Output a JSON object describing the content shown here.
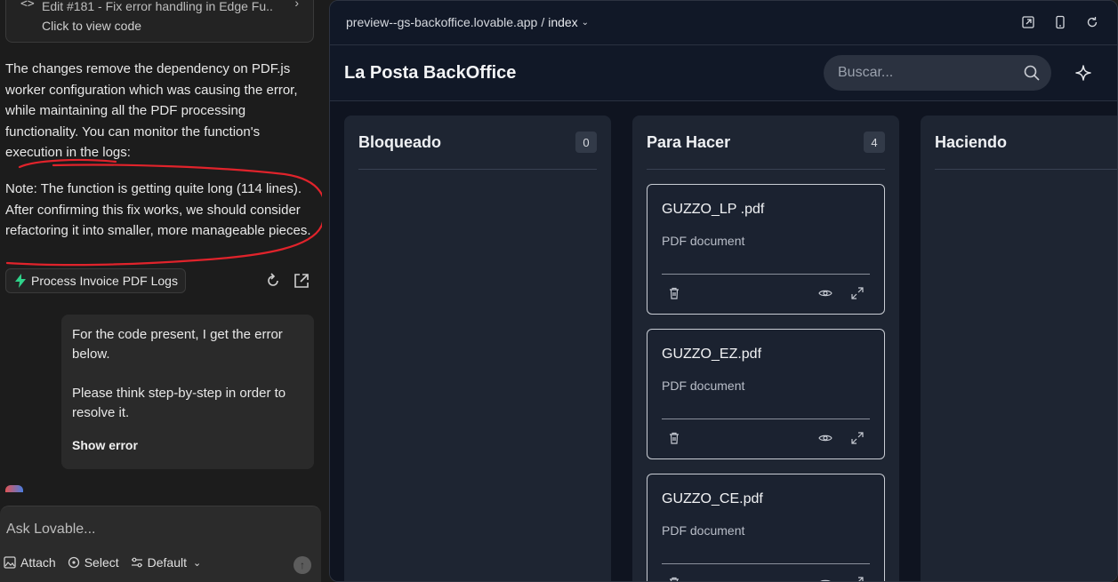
{
  "chat": {
    "code_card": {
      "glyph": "<>",
      "title": "Edit #181 - Fix error handling in Edge Fu...",
      "subtitle": "Click to view code"
    },
    "paragraph1": "The changes remove the dependency on PDF.js worker configuration which was causing the error, while maintaining all the PDF processing functionality. You can monitor the function's execution in the logs:",
    "paragraph2": "Note: The function is getting quite long (114 lines). After confirming this fix works, we should consider refactoring it into smaller, more manageable pieces.",
    "logs_chip": "Process Invoice PDF Logs",
    "user_message": {
      "line1": "For the code present, I get the error below.",
      "line2": "Please think step-by-step in order to resolve it.",
      "show_error": "Show error"
    },
    "composer": {
      "placeholder": "Ask Lovable...",
      "attach": "Attach",
      "select": "Select",
      "default": "Default"
    }
  },
  "preview": {
    "url": "preview--gs-backoffice.lovable.app",
    "separator": "/",
    "route": "index",
    "app_title": "La Posta BackOffice",
    "search_placeholder": "Buscar...",
    "columns": [
      {
        "title": "Bloqueado",
        "count": "0"
      },
      {
        "title": "Para Hacer",
        "count": "4"
      },
      {
        "title": "Haciendo"
      }
    ],
    "cards": [
      {
        "name": "GUZZO_LP .pdf",
        "desc": "PDF document"
      },
      {
        "name": "GUZZO_EZ.pdf",
        "desc": "PDF document"
      },
      {
        "name": "GUZZO_CE.pdf",
        "desc": "PDF document"
      }
    ]
  },
  "colors": {
    "annotation": "#e0232b",
    "chip_bolt": "#2fd28a"
  }
}
